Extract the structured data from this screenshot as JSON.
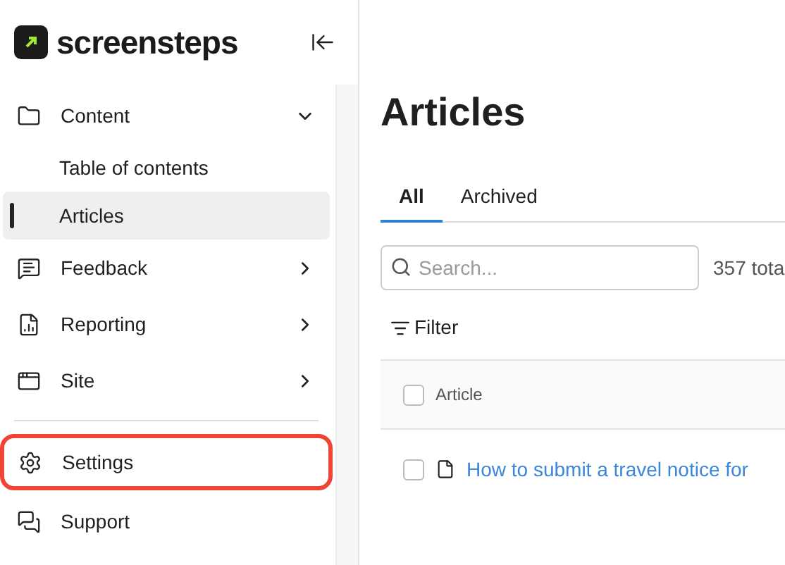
{
  "sidebar": {
    "logo": "screensteps",
    "items": [
      {
        "kind": "group",
        "label": "Content",
        "expanded": true,
        "children": [
          {
            "label": "Table of contents",
            "selected": false
          },
          {
            "label": "Articles",
            "selected": true
          }
        ]
      },
      {
        "kind": "group",
        "label": "Feedback",
        "expanded": false
      },
      {
        "kind": "group",
        "label": "Reporting",
        "expanded": false
      },
      {
        "kind": "group",
        "label": "Site",
        "expanded": false
      },
      {
        "kind": "divider"
      },
      {
        "kind": "link",
        "label": "Settings",
        "highlighted": true
      },
      {
        "kind": "link",
        "label": "Support",
        "highlighted": false
      }
    ]
  },
  "page": {
    "title": "Articles",
    "tabs": [
      {
        "label": "All",
        "selected": true
      },
      {
        "label": "Archived",
        "selected": false
      }
    ],
    "search": {
      "placeholder": "Search..."
    },
    "total": "357 tota",
    "filter": "Filter",
    "table": {
      "select_all_checked": false,
      "columns": [
        "Article"
      ],
      "rows": [
        {
          "title": "How to submit a travel notice for",
          "checked": false
        }
      ]
    }
  }
}
